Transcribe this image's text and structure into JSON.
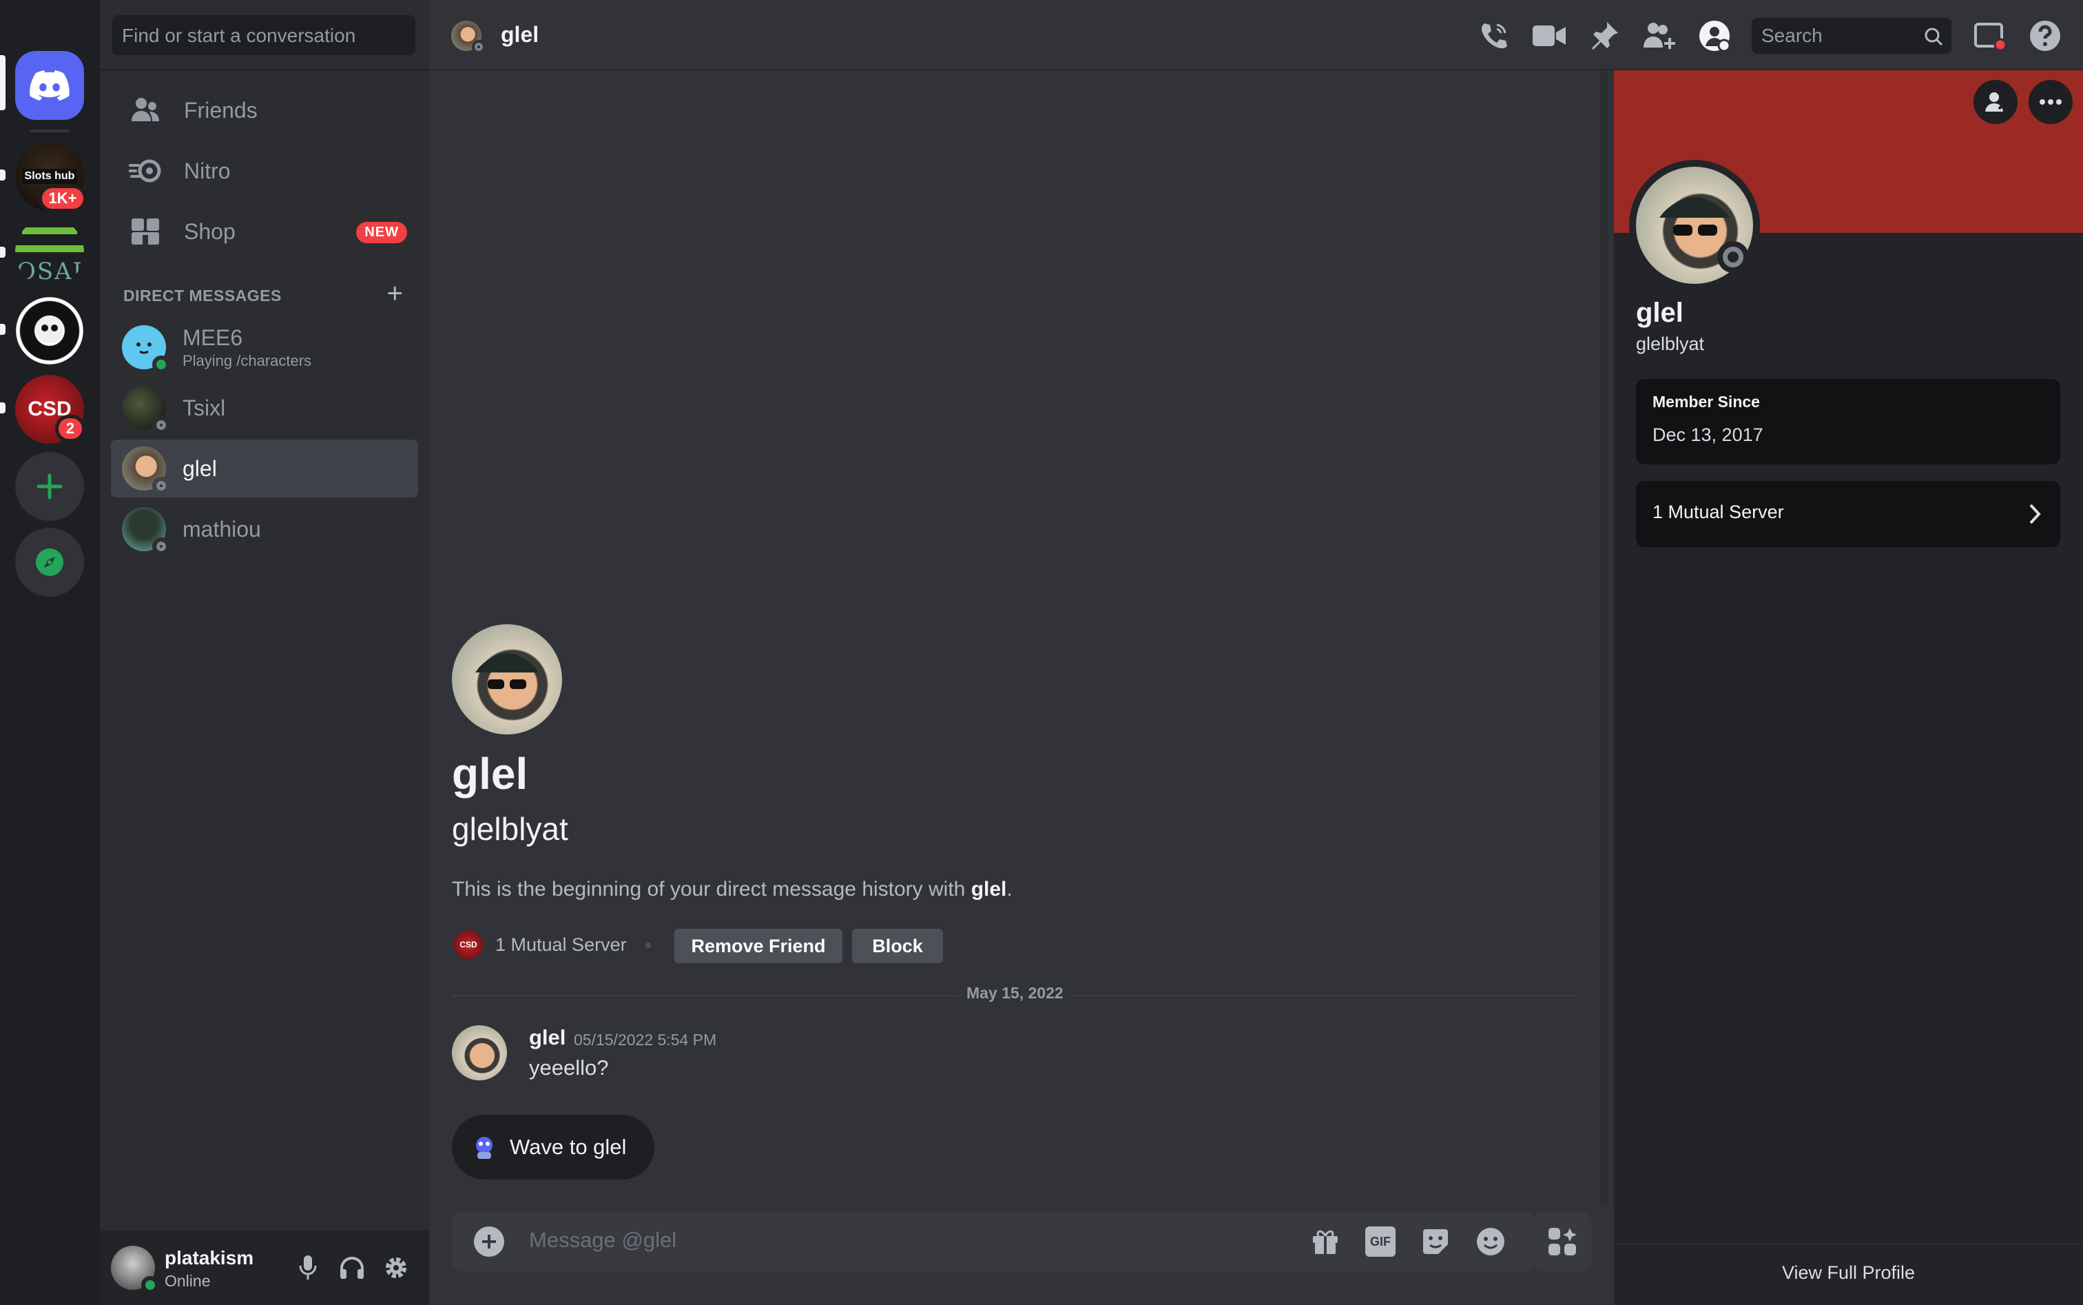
{
  "sidebar": {
    "search_placeholder": "Find or start a conversation",
    "nav": {
      "friends": "Friends",
      "nitro": "Nitro",
      "shop": "Shop",
      "shop_badge": "NEW"
    },
    "dm_header": "DIRECT MESSAGES",
    "dm_add": "+",
    "dms": [
      {
        "name": "MEE6",
        "status": "Playing /characters"
      },
      {
        "name": "Tsixl"
      },
      {
        "name": "glel"
      },
      {
        "name": "mathiou"
      }
    ]
  },
  "servers": {
    "slots_label": "Slots hub",
    "slots_badge": "1K+",
    "osau_label": "OSAU",
    "csd_label": "CSD",
    "csd_badge": "2"
  },
  "user_panel": {
    "username": "platakism",
    "status": "Online"
  },
  "topbar": {
    "channel_name": "glel",
    "search_placeholder": "Search"
  },
  "chat": {
    "intro_name": "glel",
    "intro_username": "glelblyat",
    "intro_text_prefix": "This is the beginning of your direct message history with ",
    "intro_text_name": "glel",
    "intro_text_suffix": ".",
    "mutual_server": "1 Mutual Server",
    "mutual_server_icon": "CSD",
    "remove_friend": "Remove Friend",
    "block": "Block",
    "date_divider": "May 15, 2022",
    "messages": [
      {
        "author": "glel",
        "timestamp": "05/15/2022 5:54 PM",
        "text": "yeeello?"
      }
    ],
    "wave_button": "Wave to glel",
    "composer_placeholder": "Message @glel",
    "gif_label": "GIF"
  },
  "profile": {
    "display_name": "glel",
    "username": "glelblyat",
    "member_since_label": "Member Since",
    "member_since_value": "Dec 13, 2017",
    "mutual_servers": "1 Mutual Server",
    "view_full_profile": "View Full Profile",
    "banner_color": "#9a2a23"
  },
  "colors": {
    "blurple": "#5865f2",
    "online": "#23a55a",
    "danger": "#f23f43"
  }
}
